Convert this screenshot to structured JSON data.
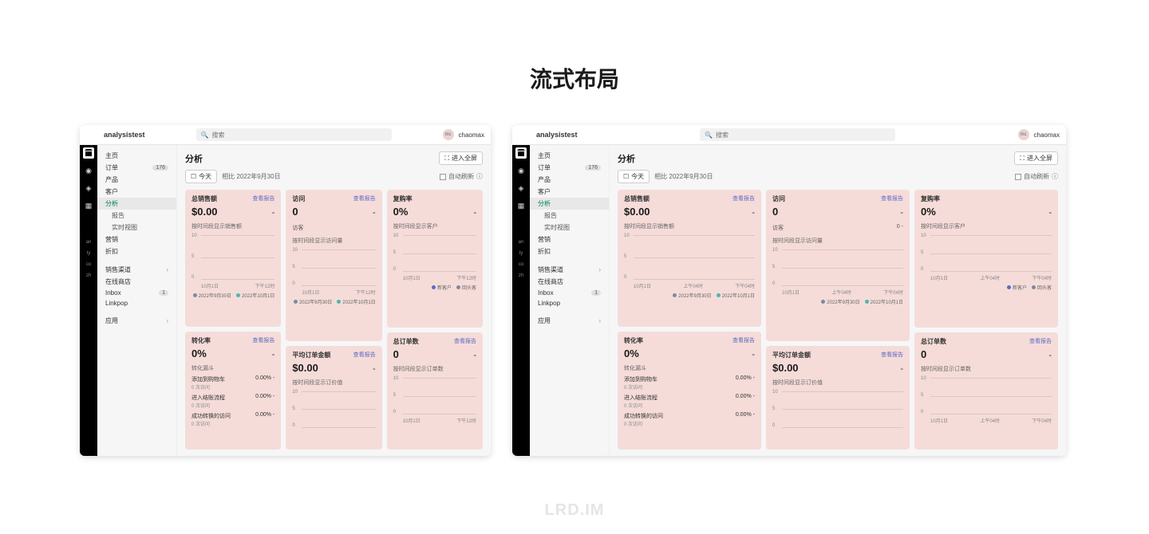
{
  "page_heading": "流式布局",
  "watermark": "LRD.IM",
  "store_name": "analysistest",
  "search_placeholder": "搜索",
  "user_initials": "mc",
  "username": "chaomax",
  "nav": {
    "home": "主页",
    "orders": "订单",
    "orders_badge": "176",
    "products": "产品",
    "customers": "客户",
    "analytics": "分析",
    "reports": "报告",
    "live_view": "实时视图",
    "marketing": "营销",
    "discounts": "折扣",
    "sales_channel": "销售渠道",
    "online_store": "在线商店",
    "inbox": "Inbox",
    "inbox_badge": "1",
    "linkpop": "Linkpop",
    "apps": "应用"
  },
  "rail_labels": [
    "an",
    "ty",
    "co",
    "zh"
  ],
  "analytics": {
    "title": "分析",
    "fullscreen": "进入全屏",
    "today": "今天",
    "compare": "相比 2022年9月30日",
    "auto_refresh": "自动刷新"
  },
  "cards": {
    "total_sales": {
      "title": "总销售额",
      "link": "查看报告",
      "value": "$0.00",
      "delta": "-",
      "desc": "按时间段显示销售额"
    },
    "visits": {
      "title": "访问",
      "link": "查看报告",
      "value": "0",
      "delta": "-",
      "visitors_label": "访客",
      "visitors_value": "0",
      "visitors_delta": "-",
      "desc": "按时间段显示访问量"
    },
    "repeat_rate": {
      "title": "复购率",
      "value": "0%",
      "delta": "-",
      "desc": "按时间段显示客户"
    },
    "conversion": {
      "title": "转化率",
      "link": "查看报告",
      "value": "0%",
      "delta": "-",
      "funnel_label": "转化漏斗",
      "funnel": [
        {
          "label": "添加到购物车",
          "sub": "0 次访问",
          "pct": "0.00%",
          "delta": "-"
        },
        {
          "label": "进入结账流程",
          "sub": "0 次访问",
          "pct": "0.00%",
          "delta": "-"
        },
        {
          "label": "成功转换的访问",
          "sub": "0 次访问",
          "pct": "0.00%",
          "delta": "-"
        }
      ]
    },
    "avg_order": {
      "title": "平均订单金额",
      "link": "查看报告",
      "value": "$0.00",
      "delta": "-",
      "desc": "按时间段显示订价值"
    },
    "total_orders": {
      "title": "总订单数",
      "link": "查看报告",
      "value": "0",
      "delta": "-",
      "desc": "按时间段显示订单数"
    }
  },
  "chart": {
    "y_ticks": [
      "10",
      "5",
      "0"
    ],
    "x_narrow": [
      "10月1日",
      "下午12时"
    ],
    "x_wide": [
      "10月1日",
      "上午04时",
      "下午04时"
    ],
    "legend_dates": [
      "2022年9月30日",
      "2022年10月1日"
    ],
    "legend_customers": [
      "新客户",
      "回头客"
    ]
  },
  "colors": {
    "legend1": "#7a8aa0",
    "legend2": "#4db6ac",
    "new_customer": "#5c6ac4",
    "returning": "#7a8aa0"
  }
}
